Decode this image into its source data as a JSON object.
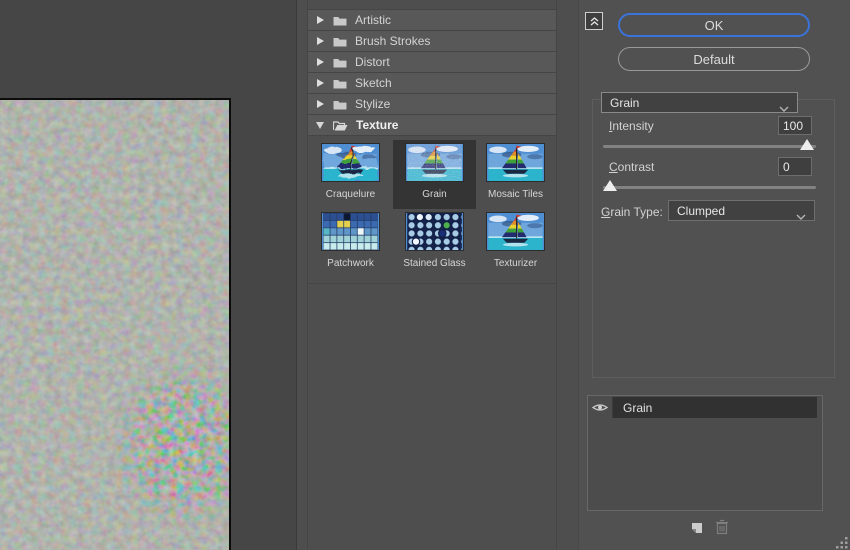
{
  "colors": {
    "accent_blue": "#3a73d9"
  },
  "filter_list": {
    "categories": [
      {
        "label": "Artistic",
        "expanded": false
      },
      {
        "label": "Brush Strokes",
        "expanded": false
      },
      {
        "label": "Distort",
        "expanded": false
      },
      {
        "label": "Sketch",
        "expanded": false
      },
      {
        "label": "Stylize",
        "expanded": false
      },
      {
        "label": "Texture",
        "expanded": true
      }
    ],
    "texture_thumbnails": [
      {
        "label": "Craquelure",
        "selected": false
      },
      {
        "label": "Grain",
        "selected": true
      },
      {
        "label": "Mosaic Tiles",
        "selected": false
      },
      {
        "label": "Patchwork",
        "selected": false
      },
      {
        "label": "Stained Glass",
        "selected": false
      },
      {
        "label": "Texturizer",
        "selected": false
      }
    ]
  },
  "buttons": {
    "ok": "OK",
    "default": "Default"
  },
  "filter_select": {
    "value": "Grain"
  },
  "settings": {
    "intensity": {
      "label": "Intensity",
      "value": "100",
      "slider_percent": 100
    },
    "contrast": {
      "label": "Contrast",
      "value": "0",
      "slider_percent": 0
    },
    "grain_type": {
      "label": "Grain Type:",
      "value": "Clumped"
    }
  },
  "effect_layers": {
    "items": [
      {
        "name": "Grain",
        "visible": true
      }
    ]
  }
}
